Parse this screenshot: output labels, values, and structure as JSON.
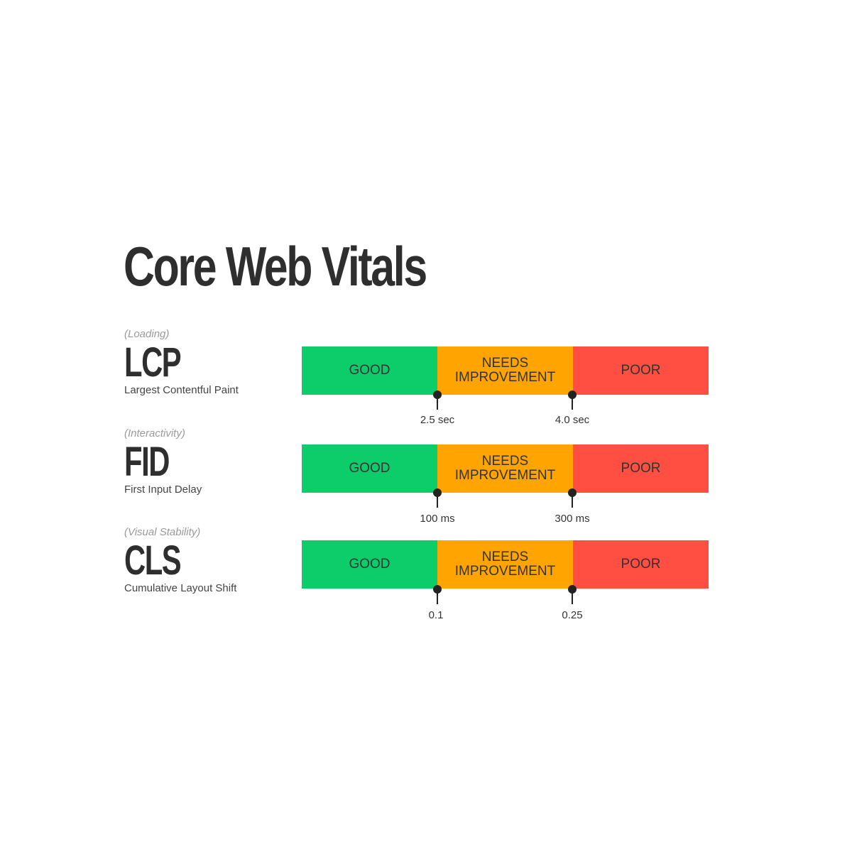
{
  "title": "Core Web Vitals",
  "segment_colors": {
    "good": "#0ccd6a",
    "needs_improvement": "#ffa400",
    "poor": "#ff4e42"
  },
  "metrics": [
    {
      "category": "(Loading)",
      "acronym": "LCP",
      "name": "Largest Contentful Paint",
      "segments": [
        "GOOD",
        "NEEDS IMPROVEMENT",
        "POOR"
      ],
      "thresholds": [
        "2.5 sec",
        "4.0 sec"
      ]
    },
    {
      "category": "(Interactivity)",
      "acronym": "FID",
      "name": "First Input Delay",
      "segments": [
        "GOOD",
        "NEEDS IMPROVEMENT",
        "POOR"
      ],
      "thresholds": [
        "100 ms",
        "300 ms"
      ]
    },
    {
      "category": "(Visual Stability)",
      "acronym": "CLS",
      "name": "Cumulative Layout Shift",
      "segments": [
        "GOOD",
        "NEEDS IMPROVEMENT",
        "POOR"
      ],
      "thresholds": [
        "0.1",
        "0.25"
      ]
    }
  ]
}
